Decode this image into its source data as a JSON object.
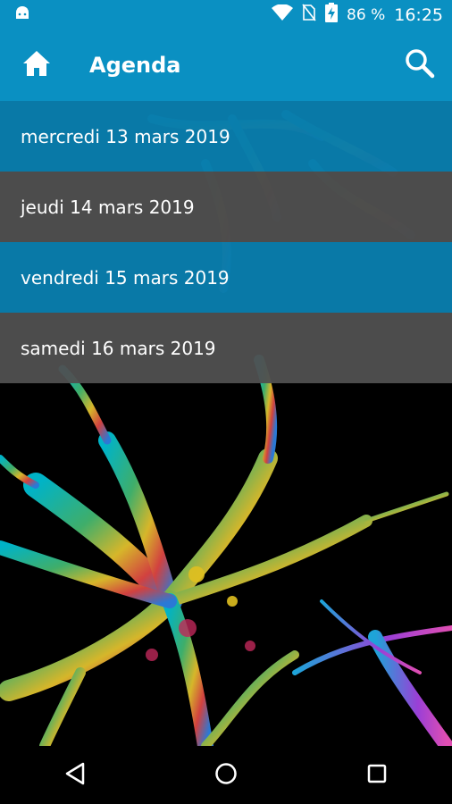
{
  "status_bar": {
    "battery": "86 %",
    "time": "16:25"
  },
  "app_bar": {
    "title": "Agenda"
  },
  "agenda": {
    "days": [
      {
        "label": "mercredi 13 mars 2019"
      },
      {
        "label": "jeudi 14 mars 2019"
      },
      {
        "label": "vendredi 15 mars 2019"
      },
      {
        "label": "samedi 16 mars 2019"
      }
    ]
  },
  "icons": {
    "android": "android-icon",
    "wifi": "wifi-icon",
    "no_sim": "no-sim-icon",
    "battery": "battery-charging-icon",
    "home": "home-icon",
    "search": "search-icon",
    "back": "back-triangle-icon",
    "nav_home": "home-circle-icon",
    "recents": "recents-square-icon"
  },
  "colors": {
    "primary": "#0a90c2",
    "row_blue": "#0a8abe",
    "row_grey": "#505050"
  }
}
